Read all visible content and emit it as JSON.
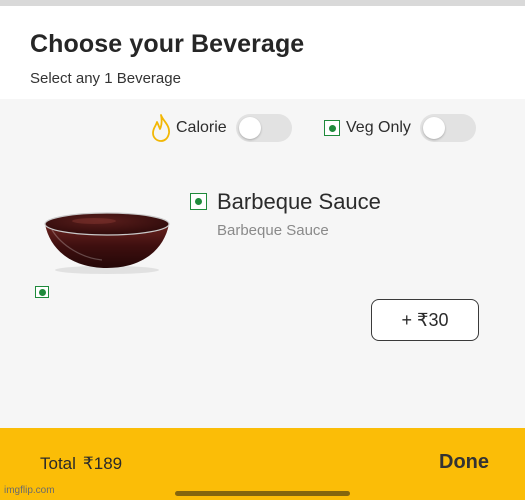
{
  "header": {
    "title": "Choose your Beverage",
    "subtitle": "Select any 1 Beverage"
  },
  "filters": {
    "calorie_label": "Calorie",
    "calorie_on": false,
    "veg_label": "Veg Only",
    "veg_on": false
  },
  "item": {
    "name": "Barbeque Sauce",
    "description": "Barbeque Sauce",
    "price_label": "+ ₹30",
    "image_icon": "sauce-bowl-image"
  },
  "footer": {
    "total_label": "Total",
    "total_amount": "₹189",
    "done_label": "Done"
  },
  "watermark": "imgflip.com",
  "colors": {
    "accent": "#fbbd07",
    "veg_green": "#1f8a3b",
    "toggle_off": "#e2e2e2",
    "content_bg": "#f6f6f6"
  }
}
